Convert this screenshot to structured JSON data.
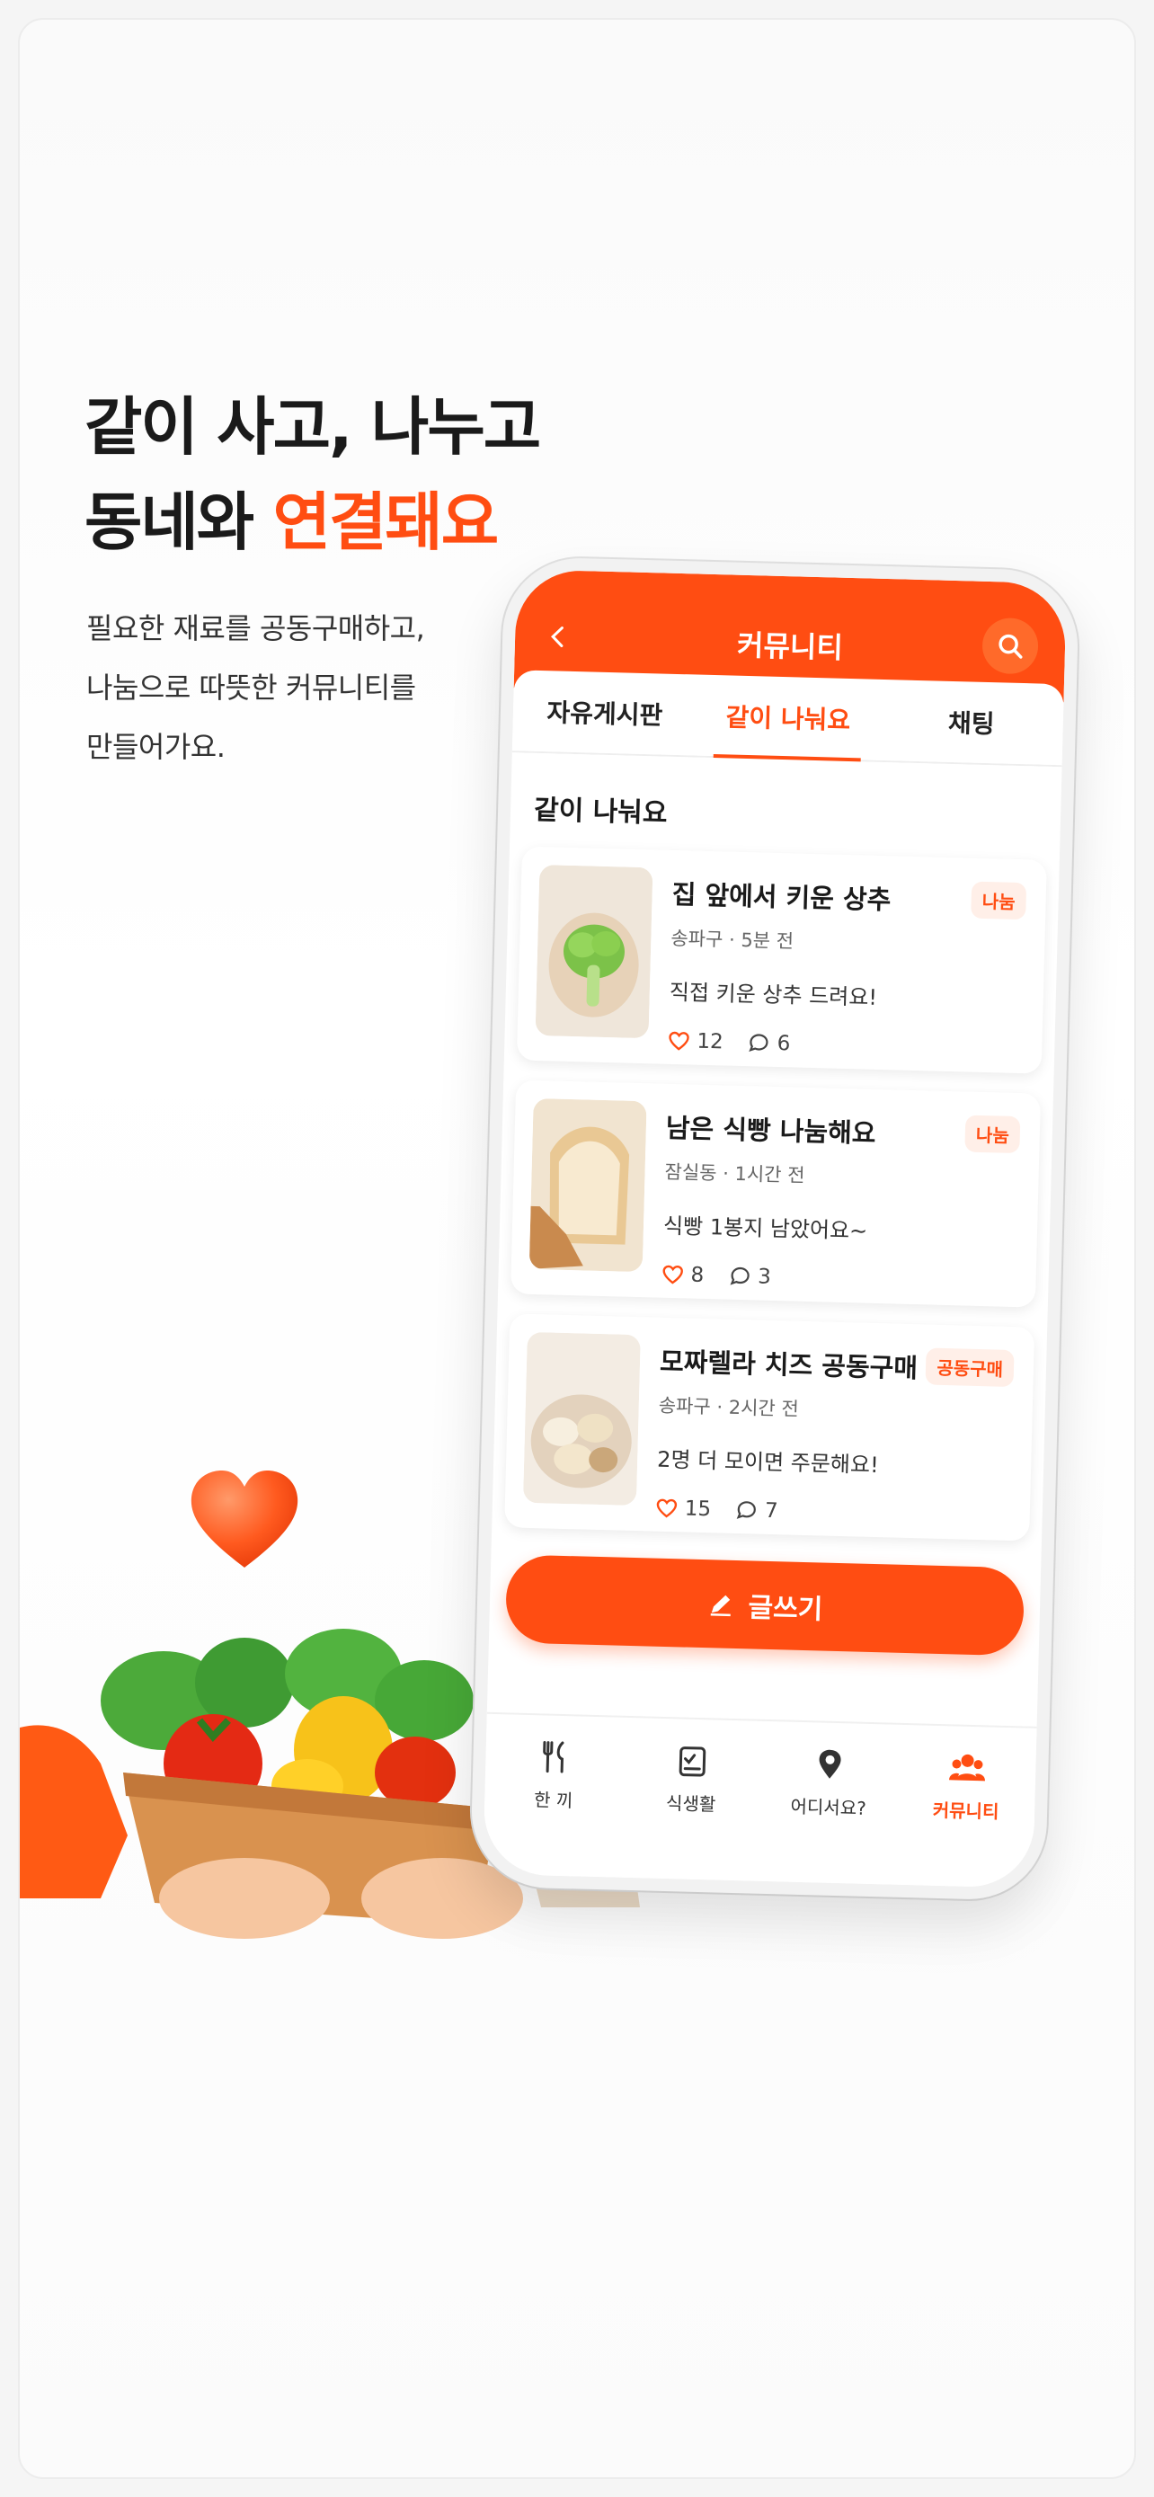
{
  "theme": {
    "accent": "#ff4d12",
    "accent_light": "#ffefe8"
  },
  "hero": {
    "line1": "같이 사고, 나누고",
    "line2_prefix": "동네와 ",
    "line2_accent": "연결돼요",
    "sub1": "필요한 재료를 공동구매하고,",
    "sub2": "나눔으로 따뜻한 커뮤니티를",
    "sub3": "만들어가요."
  },
  "app": {
    "title": "커뮤니티",
    "tabs": [
      {
        "label": "자유게시판",
        "active": false
      },
      {
        "label": "같이 나눠요",
        "active": true
      },
      {
        "label": "채팅",
        "active": false
      }
    ],
    "section_title": "같이 나눠요",
    "posts": [
      {
        "title": "집 앞에서 키운 상추",
        "location": "송파구",
        "time": "5분 전",
        "meta": "송파구 · 5분 전",
        "desc": "직접 키운 상추 드려요!",
        "likes": "12",
        "comments": "6",
        "badge": "나눔",
        "thumb": "lettuce"
      },
      {
        "title": "남은 식빵 나눔해요",
        "location": "잠실동",
        "time": "1시간 전",
        "meta": "잠실동 · 1시간 전",
        "desc": "식빵 1봉지 남았어요~",
        "likes": "8",
        "comments": "3",
        "badge": "나눔",
        "thumb": "bread"
      },
      {
        "title": "모짜렐라 치즈 공동구매",
        "location": "송파구",
        "time": "2시간 전",
        "meta": "송파구 · 2시간 전",
        "desc": "2명 더 모이면 주문해요!",
        "likes": "15",
        "comments": "7",
        "badge": "공동구매",
        "thumb": "cheese"
      }
    ],
    "write_button": "글쓰기",
    "nav": [
      {
        "label": "한 끼",
        "icon": "fork-knife-icon",
        "active": false
      },
      {
        "label": "식생활",
        "icon": "checklist-icon",
        "active": false
      },
      {
        "label": "어디서요?",
        "icon": "location-pin-icon",
        "active": false
      },
      {
        "label": "커뮤니티",
        "icon": "community-icon",
        "active": true
      }
    ]
  }
}
